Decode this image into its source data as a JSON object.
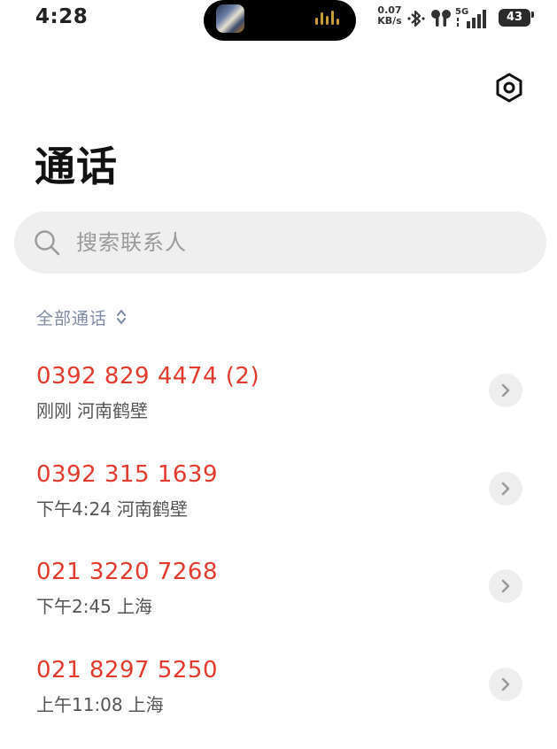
{
  "status_bar": {
    "time": "4:28",
    "net_speed_value": "0.07",
    "net_speed_unit": "KB/s",
    "network": "5G",
    "battery": "43"
  },
  "header": {
    "title": "通话"
  },
  "search": {
    "placeholder": "搜索联系人"
  },
  "filter": {
    "label": "全部通话"
  },
  "calls": [
    {
      "number": "0392 829 4474 (2)",
      "time": "刚刚",
      "location": "河南鹤壁"
    },
    {
      "number": "0392 315 1639",
      "time": "下午4:24",
      "location": "河南鹤壁"
    },
    {
      "number": "021 3220 7268",
      "time": "下午2:45",
      "location": "上海"
    },
    {
      "number": "021 8297 5250",
      "time": "上午11:08",
      "location": "上海"
    }
  ],
  "colors": {
    "missed_call": "#e33b2e",
    "filter_text": "#7c8aa3",
    "search_bg": "#efefef"
  },
  "icons": {
    "settings": "hexagon-settings-icon",
    "search": "magnifier-icon",
    "filter": "sort-updown-icon",
    "detail": "chevron-right-icon"
  }
}
